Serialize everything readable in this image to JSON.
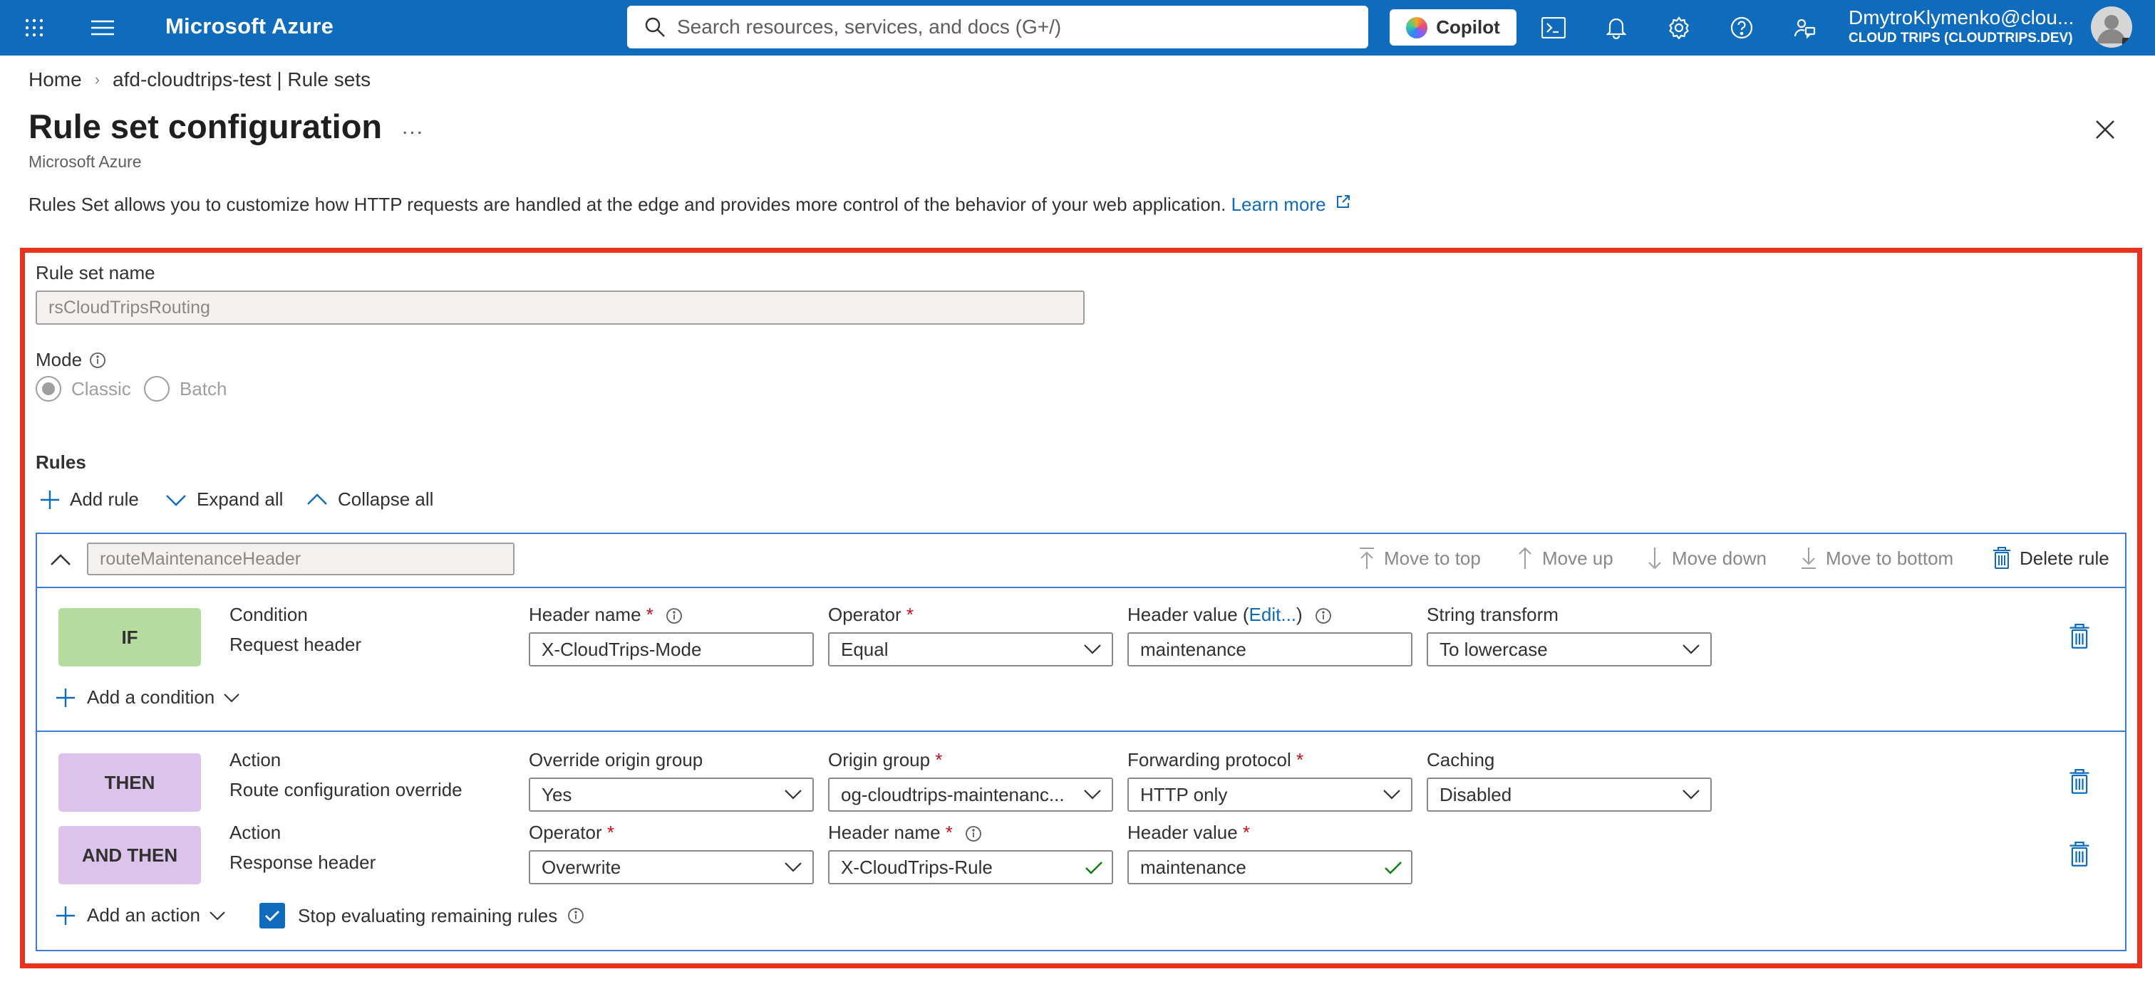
{
  "topbar": {
    "brand": "Microsoft Azure",
    "search_placeholder": "Search resources, services, and docs (G+/)",
    "copilot_label": "Copilot",
    "account_user": "DmytroKlymenko@clou...",
    "account_tenant": "CLOUD TRIPS (CLOUDTRIPS.DEV)",
    "icons": [
      "apps-grid-icon",
      "hamburger-menu-icon",
      "cloud-shell-icon",
      "bell-icon",
      "gear-icon",
      "help-icon",
      "feedback-icon"
    ]
  },
  "breadcrumb": {
    "home": "Home",
    "current": "afd-cloudtrips-test | Rule sets"
  },
  "header": {
    "title": "Rule set configuration",
    "more": "...",
    "subtitle": "Microsoft Azure",
    "description": "Rules Set allows you to customize how HTTP requests are handled at the edge and provides more control of the behavior of your web application. ",
    "learn_more": "Learn more"
  },
  "form": {
    "rule_set_name_label": "Rule set name",
    "rule_set_name_value": "rsCloudTripsRouting",
    "mode_label": "Mode",
    "mode_options": [
      "Classic",
      "Batch"
    ],
    "mode_selected": "Classic",
    "rules_label": "Rules",
    "toolbar": {
      "add_rule": "Add rule",
      "expand_all": "Expand all",
      "collapse_all": "Collapse all"
    }
  },
  "rule": {
    "name": "routeMaintenanceHeader",
    "actions": {
      "move_to_top": "Move to top",
      "move_up": "Move up",
      "move_down": "Move down",
      "move_to_bottom": "Move to bottom",
      "delete_rule": "Delete rule"
    },
    "condition": {
      "badge": "IF",
      "type_label": "Condition",
      "type_value": "Request header",
      "header_name_label": "Header name",
      "header_name_value": "X-CloudTrips-Mode",
      "operator_label": "Operator",
      "operator_value": "Equal",
      "header_value_label": "Header value",
      "header_value_edit": "Edit...",
      "header_value_value": "maintenance",
      "string_transform_label": "String transform",
      "string_transform_value": "To lowercase",
      "add_condition": "Add a condition"
    },
    "action1": {
      "badge": "THEN",
      "type_label": "Action",
      "type_value": "Route configuration override",
      "override_label": "Override origin group",
      "override_value": "Yes",
      "origin_group_label": "Origin group",
      "origin_group_value": "og-cloudtrips-maintenanc...",
      "forwarding_label": "Forwarding protocol",
      "forwarding_value": "HTTP only",
      "caching_label": "Caching",
      "caching_value": "Disabled"
    },
    "action2": {
      "badge": "AND THEN",
      "type_label": "Action",
      "type_value": "Response header",
      "operator_label": "Operator",
      "operator_value": "Overwrite",
      "header_name_label": "Header name",
      "header_name_value": "X-CloudTrips-Rule",
      "header_value_label": "Header value",
      "header_value_value": "maintenance"
    },
    "add_action": "Add an action",
    "stop_evaluating": "Stop evaluating remaining rules",
    "stop_evaluating_checked": true
  },
  "colors": {
    "azure_blue": "#0f6cbd",
    "if_badge": "#b5dba0",
    "then_badge": "#dcc3ec",
    "highlight": "#e8331f",
    "required": "#c50f1f"
  }
}
